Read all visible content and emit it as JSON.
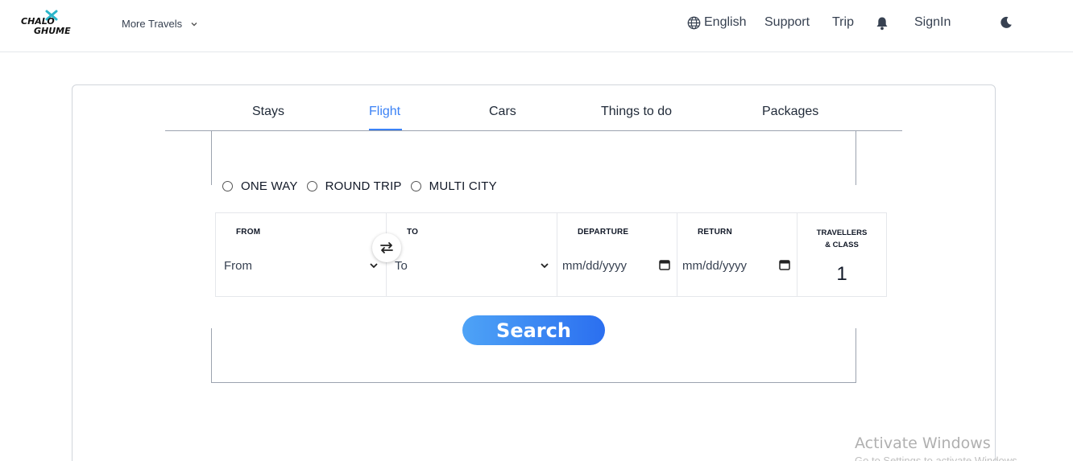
{
  "header": {
    "logo_text_top": "CHALO",
    "logo_text_bottom": "GHUME",
    "more_travels": "More Travels",
    "language": "English",
    "support": "Support",
    "trip": "Trip",
    "signin": "SignIn",
    "icons": [
      "globe-icon",
      "bell-icon",
      "moon-icon",
      "chevron-down-icon",
      "plane-icon"
    ]
  },
  "tabs": [
    {
      "label": "Stays",
      "active": false
    },
    {
      "label": "Flight",
      "active": true
    },
    {
      "label": "Cars",
      "active": false
    },
    {
      "label": "Things to do",
      "active": false
    },
    {
      "label": "Packages",
      "active": false
    }
  ],
  "trip_types": [
    {
      "label": "ONE WAY",
      "selected": false
    },
    {
      "label": "ROUND TRIP",
      "selected": false
    },
    {
      "label": "MULTI CITY",
      "selected": false
    }
  ],
  "search_form": {
    "from": {
      "label": "FROM",
      "value": "From"
    },
    "to": {
      "label": "TO",
      "value": "To"
    },
    "departure": {
      "label": "DEPARTURE",
      "value": "mm/dd/yyyy"
    },
    "return": {
      "label": "RETURN",
      "value": "mm/dd/yyyy"
    },
    "travellers": {
      "label_line1": "TRAVELLERS",
      "label_line2": "& CLASS",
      "value": "1"
    }
  },
  "search_button": "Search",
  "watermark": {
    "title": "Activate Windows",
    "subtitle": "Go to Settings to activate Windows."
  },
  "colors": {
    "accent": "#3b82f6",
    "button_start": "#4ea3f6",
    "button_end": "#2b6ff0",
    "logo_accent": "#2bb5c9"
  }
}
